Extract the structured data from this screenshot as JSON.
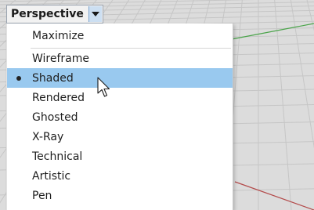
{
  "viewport": {
    "title": "Perspective",
    "arrow_icon": "triangle-down-icon",
    "background_color": "#dcdcdc",
    "grid_line_color": "#c6c6c6",
    "x_axis_color": "#b34a4a",
    "y_axis_color": "#4aa44a"
  },
  "menu": {
    "top_items": [
      {
        "label": "Maximize",
        "checked": false,
        "highlighted": false
      }
    ],
    "items": [
      {
        "label": "Wireframe",
        "checked": false,
        "highlighted": false
      },
      {
        "label": "Shaded",
        "checked": true,
        "highlighted": true
      },
      {
        "label": "Rendered",
        "checked": false,
        "highlighted": false
      },
      {
        "label": "Ghosted",
        "checked": false,
        "highlighted": false
      },
      {
        "label": "X-Ray",
        "checked": false,
        "highlighted": false
      },
      {
        "label": "Technical",
        "checked": false,
        "highlighted": false
      },
      {
        "label": "Artistic",
        "checked": false,
        "highlighted": false
      },
      {
        "label": "Pen",
        "checked": false,
        "highlighted": false
      }
    ],
    "highlight_color": "#99c9ef",
    "check_icon": "bullet-icon"
  },
  "cursor": {
    "icon": "mouse-pointer-icon"
  }
}
